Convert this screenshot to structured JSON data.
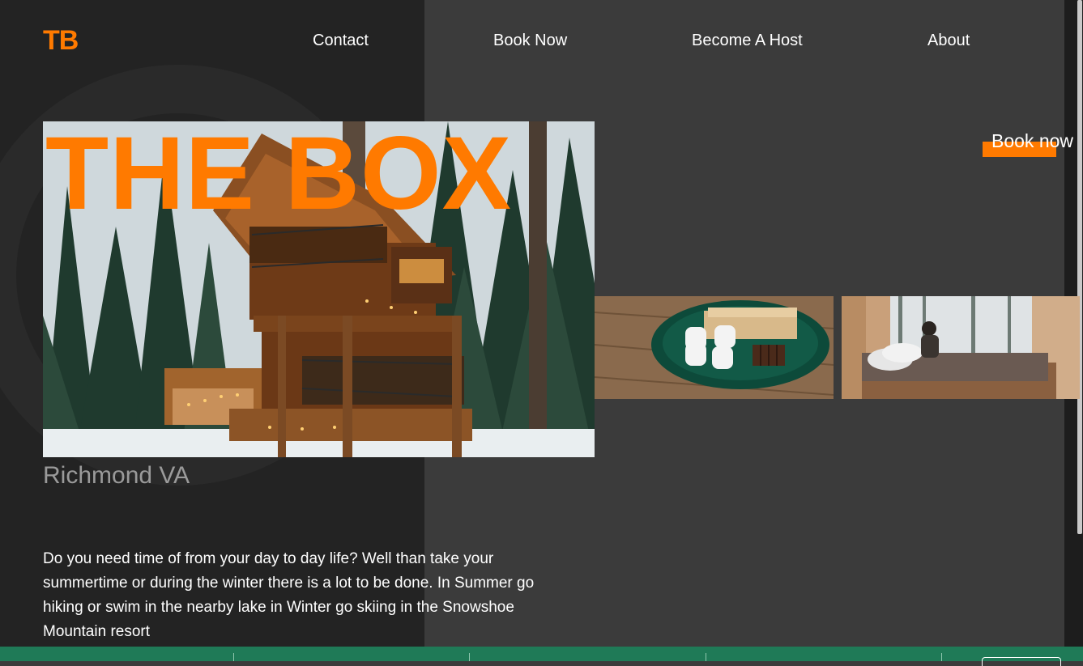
{
  "brand": {
    "logo": "TB",
    "accent": "#ff7a00"
  },
  "nav": {
    "items": [
      "Contact",
      "Book Now",
      "Become A Host",
      "About"
    ]
  },
  "hero": {
    "title": "THE BOX",
    "image": "treehouse-photo"
  },
  "cta": {
    "book_label": "Book now"
  },
  "gallery": [
    {
      "image": "smores-plate-photo"
    },
    {
      "image": "cabin-bed-photo"
    }
  ],
  "location": "Richmond VA",
  "description": "Do you need time of from your day to day life? Well than take your summertime or during the winter there is a lot to be done. In Summer go hiking or swim in the nearby lake in Winter go skiing in the Snowshoe Mountain resort",
  "footer": {
    "color": "#1f7a57"
  }
}
